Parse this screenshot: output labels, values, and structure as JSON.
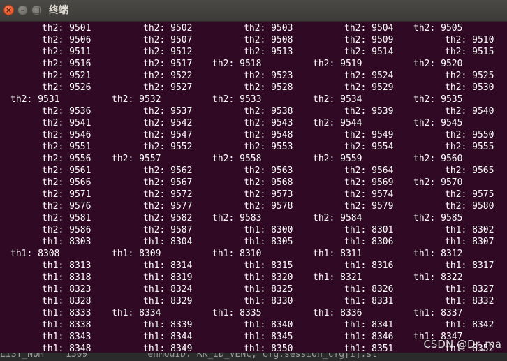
{
  "window": {
    "title": "终端"
  },
  "terminal": {
    "lines": [
      [
        [
          60,
          "th2: 9501"
        ],
        [
          205,
          "th2: 9502"
        ],
        [
          349,
          "th2: 9503"
        ],
        [
          493,
          "th2: 9504"
        ],
        [
          592,
          "th2: 9505"
        ]
      ],
      [
        [
          60,
          "th2: 9506"
        ],
        [
          205,
          "th2: 9507"
        ],
        [
          349,
          "th2: 9508"
        ],
        [
          493,
          "th2: 9509"
        ],
        [
          637,
          "th2: 9510"
        ]
      ],
      [
        [
          60,
          "th2: 9511"
        ],
        [
          205,
          "th2: 9512"
        ],
        [
          349,
          "th2: 9513"
        ],
        [
          493,
          "th2: 9514"
        ],
        [
          637,
          "th2: 9515"
        ]
      ],
      [
        [
          60,
          "th2: 9516"
        ],
        [
          205,
          "th2: 9517"
        ],
        [
          304,
          "th2: 9518"
        ],
        [
          448,
          "th2: 9519"
        ],
        [
          592,
          "th2: 9520"
        ]
      ],
      [
        [
          60,
          "th2: 9521"
        ],
        [
          205,
          "th2: 9522"
        ],
        [
          349,
          "th2: 9523"
        ],
        [
          493,
          "th2: 9524"
        ],
        [
          637,
          "th2: 9525"
        ]
      ],
      [
        [
          60,
          "th2: 9526"
        ],
        [
          205,
          "th2: 9527"
        ],
        [
          349,
          "th2: 9528"
        ],
        [
          493,
          "th2: 9529"
        ],
        [
          637,
          "th2: 9530"
        ]
      ],
      [
        [
          15,
          "th2: 9531"
        ],
        [
          160,
          "th2: 9532"
        ],
        [
          304,
          "th2: 9533"
        ],
        [
          448,
          "th2: 9534"
        ],
        [
          592,
          "th2: 9535"
        ]
      ],
      [
        [
          60,
          "th2: 9536"
        ],
        [
          205,
          "th2: 9537"
        ],
        [
          349,
          "th2: 9538"
        ],
        [
          493,
          "th2: 9539"
        ],
        [
          637,
          "th2: 9540"
        ]
      ],
      [
        [
          60,
          "th2: 9541"
        ],
        [
          205,
          "th2: 9542"
        ],
        [
          349,
          "th2: 9543"
        ],
        [
          448,
          "th2: 9544"
        ],
        [
          592,
          "th2: 9545"
        ]
      ],
      [
        [
          60,
          "th2: 9546"
        ],
        [
          205,
          "th2: 9547"
        ],
        [
          349,
          "th2: 9548"
        ],
        [
          493,
          "th2: 9549"
        ],
        [
          637,
          "th2: 9550"
        ]
      ],
      [
        [
          60,
          "th2: 9551"
        ],
        [
          205,
          "th2: 9552"
        ],
        [
          349,
          "th2: 9553"
        ],
        [
          493,
          "th2: 9554"
        ],
        [
          637,
          "th2: 9555"
        ]
      ],
      [
        [
          60,
          "th2: 9556"
        ],
        [
          160,
          "th2: 9557"
        ],
        [
          304,
          "th2: 9558"
        ],
        [
          448,
          "th2: 9559"
        ],
        [
          592,
          "th2: 9560"
        ]
      ],
      [
        [
          60,
          "th2: 9561"
        ],
        [
          205,
          "th2: 9562"
        ],
        [
          349,
          "th2: 9563"
        ],
        [
          493,
          "th2: 9564"
        ],
        [
          637,
          "th2: 9565"
        ]
      ],
      [
        [
          60,
          "th2: 9566"
        ],
        [
          205,
          "th2: 9567"
        ],
        [
          349,
          "th2: 9568"
        ],
        [
          493,
          "th2: 9569"
        ],
        [
          592,
          "th2: 9570"
        ]
      ],
      [
        [
          60,
          "th2: 9571"
        ],
        [
          205,
          "th2: 9572"
        ],
        [
          349,
          "th2: 9573"
        ],
        [
          493,
          "th2: 9574"
        ],
        [
          637,
          "th2: 9575"
        ]
      ],
      [
        [
          60,
          "th2: 9576"
        ],
        [
          205,
          "th2: 9577"
        ],
        [
          349,
          "th2: 9578"
        ],
        [
          493,
          "th2: 9579"
        ],
        [
          637,
          "th2: 9580"
        ]
      ],
      [
        [
          60,
          "th2: 9581"
        ],
        [
          205,
          "th2: 9582"
        ],
        [
          304,
          "th2: 9583"
        ],
        [
          448,
          "th2: 9584"
        ],
        [
          592,
          "th2: 9585"
        ]
      ],
      [
        [
          60,
          "th2: 9586"
        ],
        [
          205,
          "th2: 9587"
        ],
        [
          349,
          "th1: 8300"
        ],
        [
          493,
          "th1: 8301"
        ],
        [
          637,
          "th1: 8302"
        ]
      ],
      [
        [
          60,
          "th1: 8303"
        ],
        [
          205,
          "th1: 8304"
        ],
        [
          349,
          "th1: 8305"
        ],
        [
          493,
          "th1: 8306"
        ],
        [
          637,
          "th1: 8307"
        ]
      ],
      [
        [
          15,
          "th1: 8308"
        ],
        [
          160,
          "th1: 8309"
        ],
        [
          304,
          "th1: 8310"
        ],
        [
          448,
          "th1: 8311"
        ],
        [
          592,
          "th1: 8312"
        ]
      ],
      [
        [
          60,
          "th1: 8313"
        ],
        [
          205,
          "th1: 8314"
        ],
        [
          349,
          "th1: 8315"
        ],
        [
          493,
          "th1: 8316"
        ],
        [
          637,
          "th1: 8317"
        ]
      ],
      [
        [
          60,
          "th1: 8318"
        ],
        [
          205,
          "th1: 8319"
        ],
        [
          349,
          "th1: 8320"
        ],
        [
          448,
          "th1: 8321"
        ],
        [
          592,
          "th1: 8322"
        ]
      ],
      [
        [
          60,
          "th1: 8323"
        ],
        [
          205,
          "th1: 8324"
        ],
        [
          349,
          "th1: 8325"
        ],
        [
          493,
          "th1: 8326"
        ],
        [
          637,
          "th1: 8327"
        ]
      ],
      [
        [
          60,
          "th1: 8328"
        ],
        [
          205,
          "th1: 8329"
        ],
        [
          349,
          "th1: 8330"
        ],
        [
          493,
          "th1: 8331"
        ],
        [
          637,
          "th1: 8332"
        ]
      ],
      [
        [
          60,
          "th1: 8333"
        ],
        [
          160,
          "th1: 8334"
        ],
        [
          304,
          "th1: 8335"
        ],
        [
          448,
          "th1: 8336"
        ],
        [
          592,
          "th1: 8337"
        ]
      ],
      [
        [
          60,
          "th1: 8338"
        ],
        [
          205,
          "th1: 8339"
        ],
        [
          349,
          "th1: 8340"
        ],
        [
          493,
          "th1: 8341"
        ],
        [
          637,
          "th1: 8342"
        ]
      ],
      [
        [
          60,
          "th1: 8343"
        ],
        [
          205,
          "th1: 8344"
        ],
        [
          349,
          "th1: 8345"
        ],
        [
          493,
          "th1: 8346"
        ],
        [
          592,
          "th1: 8347"
        ]
      ],
      [
        [
          60,
          "th1: 8348"
        ],
        [
          205,
          "th1: 8349"
        ],
        [
          349,
          "th1: 8350"
        ],
        [
          493,
          "th1: 8351"
        ],
        [
          637,
          "th1: 8352"
        ]
      ]
    ]
  },
  "background_editor": {
    "text": "LIST_NUM    1309           enModID: RK_ID_VENC, cfg.session_cfg[i].st"
  },
  "watermark": "CSDN @Dr_ma",
  "colors": {
    "terminal_bg": "#300a24",
    "terminal_fg": "#ffffff",
    "titlebar": "#3c3b37",
    "close_button": "#df4a16"
  },
  "icons": {
    "close": "×",
    "minimize": "–",
    "maximize": "□"
  }
}
